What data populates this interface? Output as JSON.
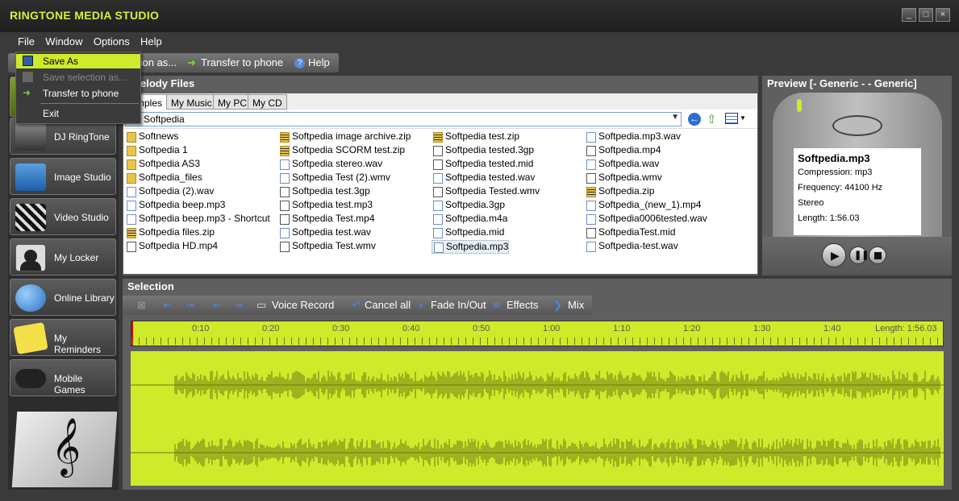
{
  "app": {
    "title": "RINGTONE MEDIA STUDIO"
  },
  "window_controls": [
    "_",
    "□",
    "×"
  ],
  "menubar": {
    "items": [
      "File",
      "Window",
      "Options",
      "Help"
    ]
  },
  "toolbar": {
    "save_selection_label": "tion as...",
    "transfer_label": "Transfer to phone",
    "help_label": "Help"
  },
  "file_menu": {
    "items": [
      {
        "label": "Save As",
        "icon": "save-icon",
        "enabled": true,
        "highlighted": true
      },
      {
        "label": "Save selection as...",
        "icon": "save-selection-icon",
        "enabled": false
      },
      {
        "label": "Transfer to phone",
        "icon": "arrow-right-icon",
        "enabled": true
      },
      {
        "label": "Exit",
        "icon": "",
        "enabled": true
      }
    ]
  },
  "sidebar": {
    "items": [
      {
        "label": "DJ RingTone",
        "icon": "dj-icon"
      },
      {
        "label": "Image Studio",
        "icon": "image-icon"
      },
      {
        "label": "Video Studio",
        "icon": "clapper-icon"
      },
      {
        "label": "My Locker",
        "icon": "person-icon"
      },
      {
        "label": "Online Library",
        "icon": "globe-icon"
      },
      {
        "label": "My Reminders",
        "icon": "note-icon"
      },
      {
        "label": "Mobile Games",
        "icon": "gamepad-icon"
      }
    ]
  },
  "melody": {
    "title": "elody Files",
    "tabs": [
      "mples",
      "My Music",
      "My PC",
      "My CD"
    ],
    "path": "Softpedia",
    "columns": [
      [
        {
          "name": "Softnews",
          "type": "folder"
        },
        {
          "name": "Softpedia 1",
          "type": "folder"
        },
        {
          "name": "Softpedia AS3",
          "type": "folder"
        },
        {
          "name": "Softpedia_files",
          "type": "folder"
        },
        {
          "name": "Softpedia (2).wav",
          "type": "audio"
        },
        {
          "name": "Softpedia beep.mp3",
          "type": "audio"
        },
        {
          "name": "Softpedia beep.mp3 - Shortcut",
          "type": "audio"
        },
        {
          "name": "Softpedia files.zip",
          "type": "zip"
        },
        {
          "name": "Softpedia HD.mp4",
          "type": "video"
        }
      ],
      [
        {
          "name": "Softpedia image archive.zip",
          "type": "zip"
        },
        {
          "name": "Softpedia SCORM test.zip",
          "type": "zip"
        },
        {
          "name": "Softpedia stereo.wav",
          "type": "audio"
        },
        {
          "name": "Softpedia Test (2).wmv",
          "type": "audio"
        },
        {
          "name": "Softpedia test.3gp",
          "type": "video"
        },
        {
          "name": "Softpedia test.mp3",
          "type": "video"
        },
        {
          "name": "Softpedia Test.mp4",
          "type": "video"
        },
        {
          "name": "Softpedia test.wav",
          "type": "audio"
        },
        {
          "name": "Softpedia Test.wmv",
          "type": "video"
        }
      ],
      [
        {
          "name": "Softpedia test.zip",
          "type": "zip"
        },
        {
          "name": "Softpedia tested.3gp",
          "type": "video"
        },
        {
          "name": "Softpedia tested.mid",
          "type": "video"
        },
        {
          "name": "Softpedia tested.wav",
          "type": "audio"
        },
        {
          "name": "Softpedia Tested.wmv",
          "type": "video"
        },
        {
          "name": "Softpedia.3gp",
          "type": "audio"
        },
        {
          "name": "Softpedia.m4a",
          "type": "audio"
        },
        {
          "name": "Softpedia.mid",
          "type": "audio"
        },
        {
          "name": "Softpedia.mp3",
          "type": "audio",
          "selected": true
        }
      ],
      [
        {
          "name": "Softpedia.mp3.wav",
          "type": "audio"
        },
        {
          "name": "Softpedia.mp4",
          "type": "video"
        },
        {
          "name": "Softpedia.wav",
          "type": "audio"
        },
        {
          "name": "Softpedia.wmv",
          "type": "video"
        },
        {
          "name": "Softpedia.zip",
          "type": "zip"
        },
        {
          "name": "Softpedia_(new_1).mp4",
          "type": "audio"
        },
        {
          "name": "Softpedia0006tested.wav",
          "type": "audio"
        },
        {
          "name": "SoftpediaTest.mid",
          "type": "video"
        },
        {
          "name": "Softpedia-test.wav",
          "type": "audio"
        }
      ]
    ]
  },
  "preview": {
    "title": "Preview [- Generic - - Generic]",
    "filename": "Softpedia.mp3",
    "compression": "Compression: mp3",
    "frequency": "Frequency: 44100 Hz",
    "channels": "Stereo",
    "length": "Length: 1:56.03"
  },
  "selection": {
    "title": "Selection",
    "voice_record": "Voice Record",
    "cancel_all": "Cancel all",
    "fade": "Fade In/Out",
    "effects": "Effects",
    "mix": "Mix",
    "ticks": [
      "0:10",
      "0:20",
      "0:30",
      "0:40",
      "0:50",
      "1:00",
      "1:10",
      "1:20",
      "1:30",
      "1:40"
    ],
    "length_label": "Length: 1:56.03"
  },
  "colors": {
    "accent": "#cfea2b",
    "title": "#d7f03a",
    "waveform": "#6b7a12",
    "highlight": "#cfea2b"
  }
}
